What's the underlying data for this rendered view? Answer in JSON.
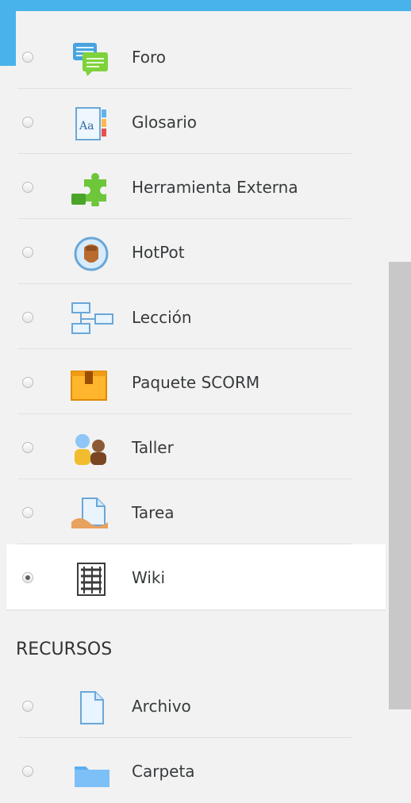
{
  "activities": [
    {
      "label": "Foro",
      "icon": "forum-icon",
      "selected": false
    },
    {
      "label": "Glosario",
      "icon": "glossary-icon",
      "selected": false
    },
    {
      "label": "Herramienta Externa",
      "icon": "external-tool-icon",
      "selected": false
    },
    {
      "label": "HotPot",
      "icon": "hotpot-icon",
      "selected": false
    },
    {
      "label": "Lección",
      "icon": "lesson-icon",
      "selected": false
    },
    {
      "label": "Paquete SCORM",
      "icon": "scorm-package-icon",
      "selected": false
    },
    {
      "label": "Taller",
      "icon": "workshop-icon",
      "selected": false
    },
    {
      "label": "Tarea",
      "icon": "assignment-icon",
      "selected": false
    },
    {
      "label": "Wiki",
      "icon": "wiki-icon",
      "selected": true
    }
  ],
  "resources_heading": "RECURSOS",
  "resources": [
    {
      "label": "Archivo",
      "icon": "file-icon",
      "selected": false
    },
    {
      "label": "Carpeta",
      "icon": "folder-icon",
      "selected": false
    }
  ],
  "colors": {
    "accent": "#48b3ea",
    "background": "#f2f2f2",
    "scroll_thumb": "#c8c8c8"
  }
}
